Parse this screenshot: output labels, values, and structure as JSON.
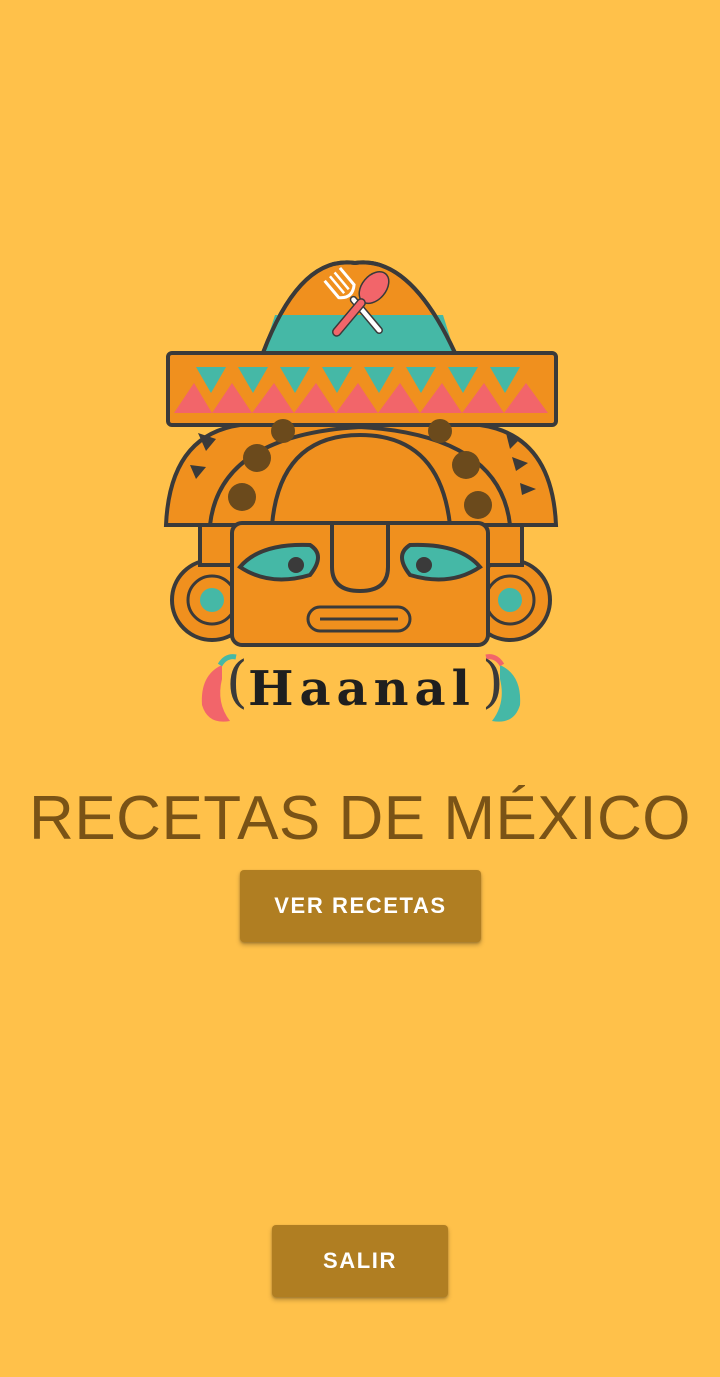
{
  "app": {
    "logo_wordmark": "Haanal"
  },
  "main": {
    "title": "RECETAS DE MÉXICO",
    "primary_button_label": "VER RECETAS",
    "exit_button_label": "SALIR"
  },
  "colors": {
    "background": "#FFC14A",
    "title_text": "#7A5316",
    "button_bg": "#B07E22",
    "button_text": "#FFFFFF",
    "logo_orange": "#F0901E",
    "logo_teal": "#45B8A6",
    "logo_red": "#F2656A",
    "logo_outline": "#3A3A3A",
    "logo_dots": "#6B4A1C"
  },
  "icons": {
    "logo": "mayan-sombrero-face-logo",
    "utensils": "fork-and-spoon-icon",
    "chili_left": "red-chili-pepper-icon",
    "chili_right": "teal-chili-pepper-icon"
  }
}
